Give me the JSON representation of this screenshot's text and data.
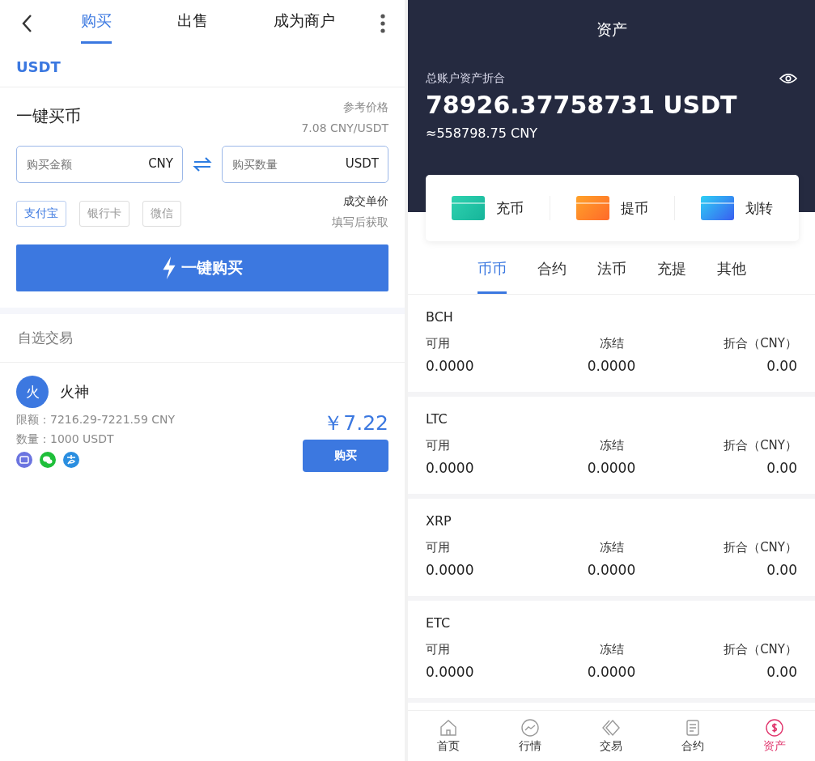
{
  "buy_screen": {
    "tabs": [
      {
        "label": "购买",
        "selected": true
      },
      {
        "label": "出售",
        "selected": false
      },
      {
        "label": "成为商户",
        "selected": false
      }
    ],
    "coin": "USDT",
    "quick_buy": {
      "title": "一键买币",
      "ref_label": "参考价格",
      "ref_price": "7.08 CNY/USDT",
      "amount_field": {
        "placeholder": "购买金额",
        "unit": "CNY"
      },
      "quantity_field": {
        "placeholder": "购买数量",
        "unit": "USDT"
      },
      "payment_methods": [
        {
          "label": "支付宝",
          "selected": true
        },
        {
          "label": "银行卡",
          "selected": false
        },
        {
          "label": "微信",
          "selected": false
        }
      ],
      "unit_price_label": "成交单价",
      "unit_price_hint": "填写后获取",
      "button": "一键购买"
    },
    "section_title": "自选交易",
    "merchants": [
      {
        "avatar": "火",
        "name": "火神",
        "limit": "限额：7216.29-7221.59 CNY",
        "quantity": "数量：1000 USDT",
        "pay_icons": [
          {
            "kind": "card",
            "color": "#6b74e0"
          },
          {
            "kind": "wechat",
            "color": "#1fbf3a"
          },
          {
            "kind": "alipay",
            "color": "#2a8ee0"
          }
        ],
        "price": "￥7.22",
        "button": "购买"
      }
    ]
  },
  "assets_screen": {
    "title": "资产",
    "total_label": "总账户资产折合",
    "total": "78926.37758731 USDT",
    "total_cny": "≈558798.75 CNY",
    "actions": [
      {
        "label": "充币",
        "kind": "deposit"
      },
      {
        "label": "提币",
        "kind": "withdraw"
      },
      {
        "label": "划转",
        "kind": "transfer"
      }
    ],
    "tabs": [
      {
        "label": "币币",
        "selected": true
      },
      {
        "label": "合约",
        "selected": false
      },
      {
        "label": "法币",
        "selected": false
      },
      {
        "label": "充提",
        "selected": false
      },
      {
        "label": "其他",
        "selected": false
      }
    ],
    "coins": [
      {
        "name": "BCH",
        "columns": [
          {
            "label": "可用",
            "value": "0.0000"
          },
          {
            "label": "冻结",
            "value": "0.0000"
          },
          {
            "label": "折合（CNY）",
            "value": "0.00"
          }
        ]
      },
      {
        "name": "LTC",
        "columns": [
          {
            "label": "可用",
            "value": "0.0000"
          },
          {
            "label": "冻结",
            "value": "0.0000"
          },
          {
            "label": "折合（CNY）",
            "value": "0.00"
          }
        ]
      },
      {
        "name": "XRP",
        "columns": [
          {
            "label": "可用",
            "value": "0.0000"
          },
          {
            "label": "冻结",
            "value": "0.0000"
          },
          {
            "label": "折合（CNY）",
            "value": "0.00"
          }
        ]
      },
      {
        "name": "ETC",
        "columns": [
          {
            "label": "可用",
            "value": "0.0000"
          },
          {
            "label": "冻结",
            "value": "0.0000"
          },
          {
            "label": "折合（CNY）",
            "value": "0.00"
          }
        ]
      }
    ],
    "nav": [
      {
        "label": "首页",
        "kind": "home",
        "selected": false
      },
      {
        "label": "行情",
        "kind": "chart",
        "selected": false
      },
      {
        "label": "交易",
        "kind": "trade",
        "selected": false
      },
      {
        "label": "合约",
        "kind": "doc",
        "selected": false
      },
      {
        "label": "资产",
        "kind": "asset",
        "selected": true
      }
    ]
  }
}
